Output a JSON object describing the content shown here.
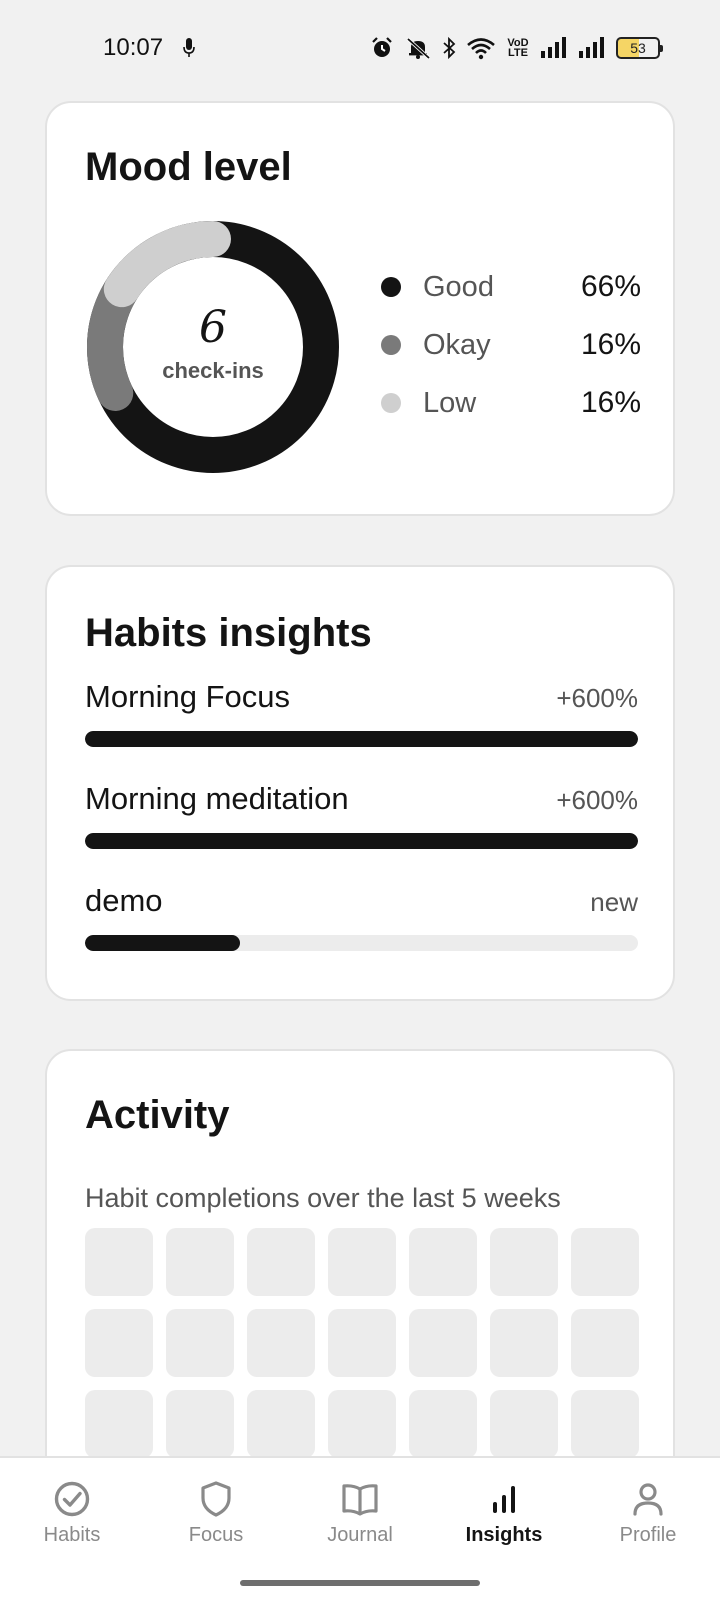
{
  "status_bar": {
    "time": "10:07",
    "battery": "53",
    "lte_label": "VoD LTE",
    "icons": [
      "mic-icon",
      "alarm-icon",
      "bell-off-icon",
      "bluetooth-icon",
      "wifi-icon",
      "lte-icon",
      "signal-icon",
      "signal-icon",
      "battery-icon"
    ]
  },
  "mood": {
    "title": "Mood level",
    "checkins_count": "6",
    "checkins_label": "check-ins",
    "legend": [
      {
        "label": "Good",
        "value": "66%",
        "color": "#141414",
        "fraction": 0.66
      },
      {
        "label": "Okay",
        "value": "16%",
        "color": "#7a7a7a",
        "fraction": 0.16
      },
      {
        "label": "Low",
        "value": "16%",
        "color": "#cfcfcf",
        "fraction": 0.16
      }
    ]
  },
  "habits": {
    "title": "Habits insights",
    "items": [
      {
        "name": "Morning Focus",
        "change": "+600%",
        "progress": 1.0
      },
      {
        "name": "Morning meditation",
        "change": "+600%",
        "progress": 1.0
      },
      {
        "name": "demo",
        "change": "new",
        "progress": 0.28
      }
    ]
  },
  "activity": {
    "title": "Activity",
    "subtitle": "Habit completions over the last 5 weeks",
    "cell_color": "#ececec"
  },
  "nav": {
    "items": [
      {
        "label": "Habits",
        "icon": "check-circle-icon",
        "active": false
      },
      {
        "label": "Focus",
        "icon": "shield-icon",
        "active": false
      },
      {
        "label": "Journal",
        "icon": "book-icon",
        "active": false
      },
      {
        "label": "Insights",
        "icon": "bar-chart-icon",
        "active": true
      },
      {
        "label": "Profile",
        "icon": "user-icon",
        "active": false
      }
    ]
  }
}
